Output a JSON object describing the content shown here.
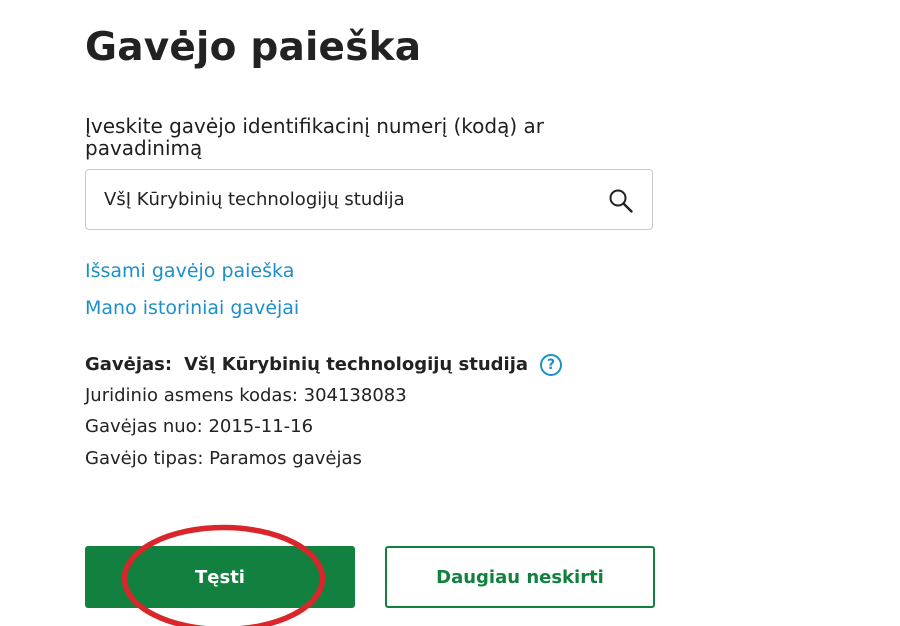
{
  "page": {
    "title": "Gavėjo paieška"
  },
  "search": {
    "label": "Įveskite gavėjo identifikacinį numerį (kodą) ar pavadinimą",
    "value": "VšĮ Kūrybinių technologijų studija",
    "icon": "search-icon"
  },
  "links": {
    "advanced_search": "Išsami gavėjo paieška",
    "history": "Mano istoriniai gavėjai"
  },
  "recipient": {
    "label": "Gavėjas:",
    "name": "VšĮ Kūrybinių technologijų studija",
    "help_icon": "?",
    "code_line": "Juridinio asmens kodas: 304138083",
    "since_line": "Gavėjas nuo: 2015-11-16",
    "type_line": "Gavėjo tipas: Paramos gavėjas"
  },
  "actions": {
    "continue_label": "Tęsti",
    "no_more_label": "Daugiau neskirti"
  },
  "colors": {
    "primary_green": "#12803e",
    "link_blue": "#1e8fc6",
    "annotation_red": "#d9262b"
  }
}
